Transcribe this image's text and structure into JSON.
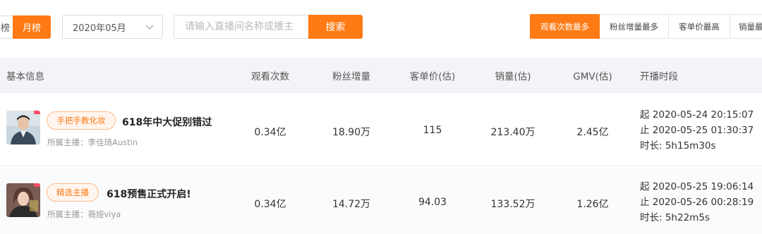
{
  "toolbar": {
    "week_tab": "榜",
    "month_tab": "月榜",
    "date_value": "2020年05月",
    "search_placeholder": "请输入直播间名称或播主",
    "search_button": "搜索",
    "sort_tabs": [
      "观看次数最多",
      "粉丝增量最多",
      "客单价最高",
      "销量最高"
    ],
    "active_sort_index": 0
  },
  "table": {
    "headers": [
      "基本信息",
      "观看次数",
      "粉丝增量",
      "客单价(估)",
      "销量(估)",
      "GMV(估)",
      "开播时段"
    ],
    "rows": [
      {
        "tag": "手把手教化妆",
        "title": "618年中大促别错过",
        "anchor_label": "所属主播：李佳琦Austin",
        "views": "0.34亿",
        "fans": "18.90万",
        "price": "115",
        "sales": "213.40万",
        "gmv": "2.45亿",
        "start": "起 2020-05-24 20:15:07",
        "end": "止 2020-05-25 01:30:37",
        "duration": "时长: 5h15m30s"
      },
      {
        "tag": "精选主播",
        "title": "618预售正式开启!",
        "anchor_label": "所属主播：薇娅viya",
        "views": "0.34亿",
        "fans": "14.72万",
        "price": "94.03",
        "sales": "133.52万",
        "gmv": "1.26亿",
        "start": "起 2020-05-25 19:06:14",
        "end": "止 2020-05-26 00:28:19",
        "duration": "时长: 5h22m5s"
      }
    ]
  },
  "colors": {
    "accent": "#ff7a14",
    "header_bg": "#f2f4f7",
    "tag_border": "#ffb98a"
  }
}
